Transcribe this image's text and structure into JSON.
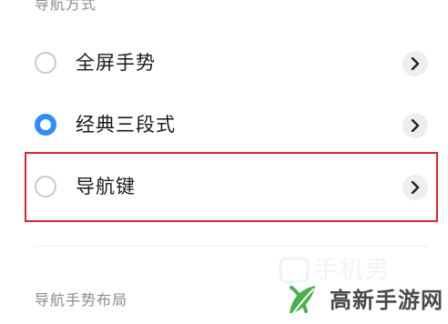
{
  "section_title": "导航方式",
  "options": [
    {
      "label": "全屏手势",
      "selected": false
    },
    {
      "label": "经典三段式",
      "selected": true
    },
    {
      "label": "导航键",
      "selected": false,
      "highlighted": true
    }
  ],
  "section_title_2": "导航手势布局",
  "watermark": {
    "text": "高新手游网",
    "icon": "leaf-logo-icon",
    "faint_text": "手机男"
  },
  "colors": {
    "accent": "#2f8cff",
    "highlight": "#e0242e",
    "watermark_green": "#49b04a"
  },
  "icons": {
    "chevron": "chevron-right-icon",
    "radio": "radio-icon"
  }
}
